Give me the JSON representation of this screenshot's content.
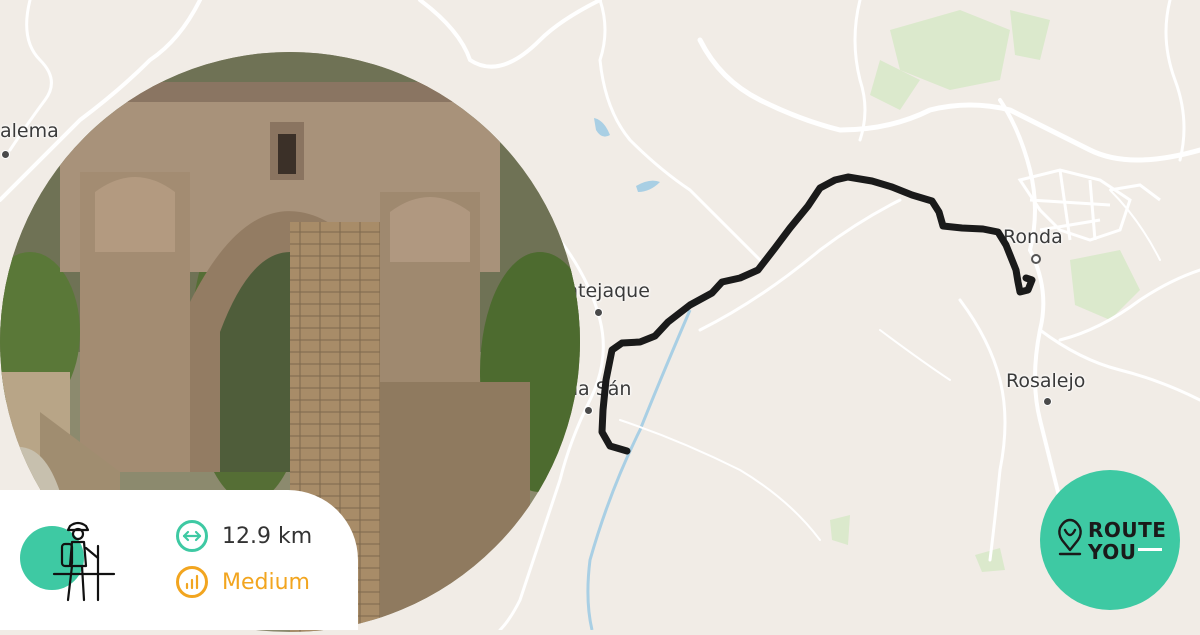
{
  "map": {
    "places": [
      {
        "name": "alema",
        "dot": "filled"
      },
      {
        "name": "ntejaque",
        "dot": "filled"
      },
      {
        "name": "na Sán",
        "dot": "filled"
      },
      {
        "name": "Ronda",
        "dot": "hollow"
      },
      {
        "name": "Rosalejo",
        "dot": "filled"
      }
    ]
  },
  "route": {
    "distance": "12.9 km",
    "difficulty": "Medium",
    "accent_color": "#3ec9a3",
    "difficulty_color": "#f2a51f",
    "line_color": "#1a1a1a"
  },
  "icons": {
    "activity": "hiker-icon",
    "distance": "distance-arrows-icon",
    "difficulty": "difficulty-bars-icon"
  },
  "brand": {
    "line1": "ROUTE",
    "line2": "YOU",
    "color": "#3ec9a3"
  }
}
